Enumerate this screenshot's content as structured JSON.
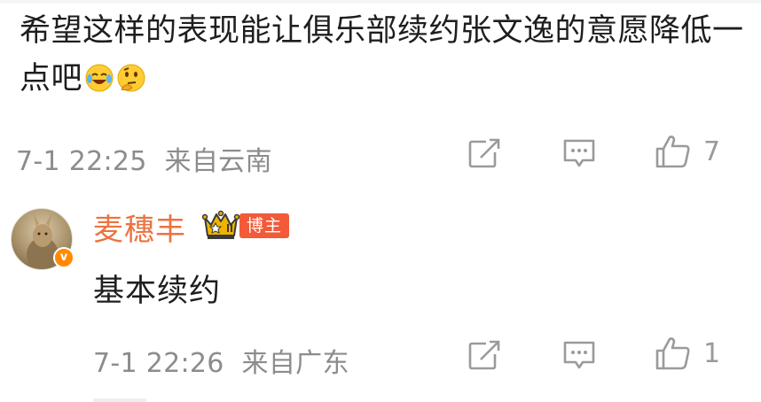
{
  "comment": {
    "text": "希望这样的表现能让俱乐部续约张文逸的意愿降低一点吧",
    "emojis": [
      "laughing-crying-emoji",
      "thinking-emoji"
    ],
    "timestamp": "7-1 22:25",
    "location": "来自云南",
    "like_count": "7"
  },
  "reply": {
    "username": "麦穗丰",
    "badge_label": "博主",
    "text": "基本续约",
    "timestamp": "7-1 22:26",
    "location": "来自广东",
    "like_count": "1"
  },
  "colors": {
    "username": "#eb7340",
    "blogger_tag": "#f25a39",
    "meta_gray": "#8c8c8c",
    "verified_badge": "#ff8a00"
  },
  "icons": [
    "share-icon",
    "comment-icon",
    "like-icon",
    "crown-icon",
    "verified-icon"
  ]
}
